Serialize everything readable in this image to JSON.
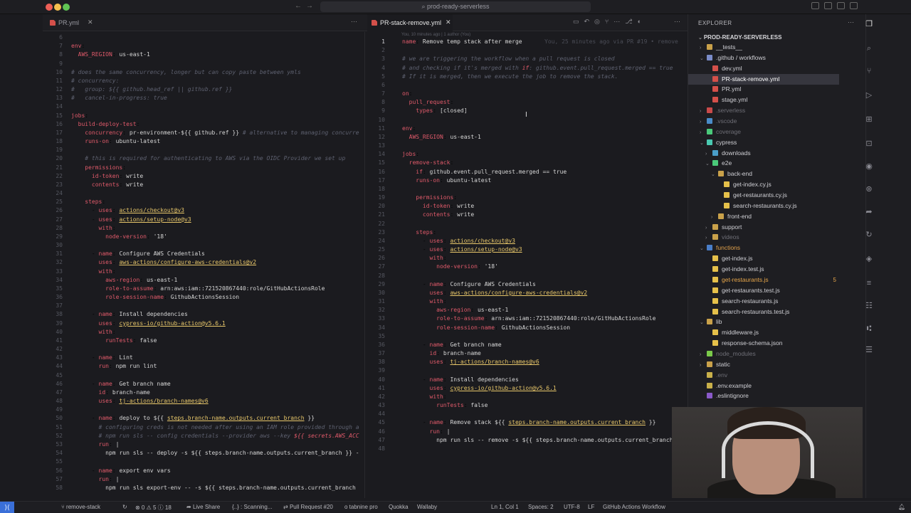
{
  "window": {
    "search_text": "prod-ready-serverless"
  },
  "tabs": {
    "left": {
      "label": "PR.yml"
    },
    "right": {
      "label": "PR-stack-remove.yml"
    }
  },
  "right_editor": {
    "blame_header": "You, 10 minutes ago | 1 author (You)",
    "inline_blame": "You, 25 minutes ago via PR #19 • remove",
    "lines": [
      {
        "n": "1",
        "html": "<span class='k'>name</span>: <span class='v'>Remove temp stack after merge</span>"
      },
      {
        "n": "2",
        "html": ""
      },
      {
        "n": "3",
        "html": "<span class='c'># we are triggering the workflow when a pull request is closed</span>"
      },
      {
        "n": "4",
        "html": "<span class='c'># and checking if it's merged with <span class='k'>if</span>: github.event.pull_request.merged == true</span>"
      },
      {
        "n": "5",
        "html": "<span class='c'># If it is merged, then we execute the job to remove the stack.</span>"
      },
      {
        "n": "6",
        "html": ""
      },
      {
        "n": "7",
        "html": "<span class='k'>on</span>:"
      },
      {
        "n": "8",
        "html": "  <span class='k'>pull_request</span>:"
      },
      {
        "n": "9",
        "html": "    <span class='k'>types</span>: <span class='v'>[closed]</span>"
      },
      {
        "n": "10",
        "html": ""
      },
      {
        "n": "11",
        "html": "<span class='k'>env</span>:"
      },
      {
        "n": "12",
        "html": "  <span class='k'>AWS_REGION</span>: <span class='v'>us-east-1</span>"
      },
      {
        "n": "13",
        "html": ""
      },
      {
        "n": "14",
        "html": "<span class='k'>jobs</span>:"
      },
      {
        "n": "15",
        "html": "  <span class='k'>remove-stack</span>:"
      },
      {
        "n": "16",
        "html": "    <span class='k'>if</span>: <span class='v'>github.event.pull_request.merged == true</span>"
      },
      {
        "n": "17",
        "html": "    <span class='k'>runs-on</span>: <span class='v'>ubuntu-latest</span>"
      },
      {
        "n": "18",
        "html": ""
      },
      {
        "n": "19",
        "html": "    <span class='k'>permissions</span>:"
      },
      {
        "n": "20",
        "html": "      <span class='k'>id-token</span>: <span class='v'>write</span>"
      },
      {
        "n": "21",
        "html": "      <span class='k'>contents</span>: <span class='v'>write</span>"
      },
      {
        "n": "22",
        "html": ""
      },
      {
        "n": "23",
        "html": "    <span class='k'>steps</span>:"
      },
      {
        "n": "24",
        "html": "      - <span class='k'>uses</span>: <span class='u'>actions/checkout@v3</span>"
      },
      {
        "n": "25",
        "html": "      - <span class='k'>uses</span>: <span class='u'>actions/setup-node@v3</span>"
      },
      {
        "n": "26",
        "html": "        <span class='k'>with</span>:"
      },
      {
        "n": "27",
        "html": "          <span class='k'>node-version</span>: <span class='v'>'18'</span>"
      },
      {
        "n": "28",
        "html": ""
      },
      {
        "n": "29",
        "html": "      - <span class='k'>name</span>: <span class='v'>Configure AWS Credentials</span>"
      },
      {
        "n": "30",
        "html": "        <span class='k'>uses</span>: <span class='u'>aws-actions/configure-aws-credentials@v2</span>"
      },
      {
        "n": "31",
        "html": "        <span class='k'>with</span>:"
      },
      {
        "n": "32",
        "html": "          <span class='k'>aws-region</span>: <span class='v'>us-east-1</span>"
      },
      {
        "n": "33",
        "html": "          <span class='k'>role-to-assume</span>: <span class='v'>arn:aws:iam::721520867440:role/GitHubActionsRole</span>"
      },
      {
        "n": "34",
        "html": "          <span class='k'>role-session-name</span>: <span class='v'>GithubActionsSession</span>"
      },
      {
        "n": "35",
        "html": ""
      },
      {
        "n": "36",
        "html": "      - <span class='k'>name</span>: <span class='v'>Get branch name</span>"
      },
      {
        "n": "37",
        "html": "        <span class='k'>id</span>: <span class='v'>branch-name</span>"
      },
      {
        "n": "38",
        "html": "        <span class='k'>uses</span>: <span class='u'>tj-actions/branch-names@v6</span>"
      },
      {
        "n": "39",
        "html": ""
      },
      {
        "n": "40",
        "html": "      - <span class='k'>name</span>: <span class='v'>Install dependencies</span>"
      },
      {
        "n": "41",
        "html": "        <span class='k'>uses</span>: <span class='u'>cypress-io/github-action@v5.6.1</span>"
      },
      {
        "n": "42",
        "html": "        <span class='k'>with</span>:"
      },
      {
        "n": "43",
        "html": "          <span class='k'>runTests</span>: <span class='v'>false</span>"
      },
      {
        "n": "44",
        "html": ""
      },
      {
        "n": "45",
        "html": "      - <span class='k'>name</span>: <span class='v'>Remove stack ${{ <span class='u'>steps.branch-name.outputs.current_branch</span> }}</span>"
      },
      {
        "n": "46",
        "html": "        <span class='k'>run</span>: <span class='v'>|</span>"
      },
      {
        "n": "47",
        "html": "          <span class='v'>npm run sls -- remove -s ${{ steps.branch-name.outputs.current_branch }}</span>"
      },
      {
        "n": "48",
        "html": ""
      }
    ]
  },
  "left_editor": {
    "lines": [
      {
        "n": "6",
        "html": ""
      },
      {
        "n": "7",
        "html": "<span class='k'>env</span>:"
      },
      {
        "n": "8",
        "html": "  <span class='k'>AWS_REGION</span>: <span class='v'>us-east-1</span>"
      },
      {
        "n": "9",
        "html": ""
      },
      {
        "n": "10",
        "html": "<span class='c'># does the same concurrency, longer but can copy paste between ymls</span>"
      },
      {
        "n": "11",
        "html": "<span class='c'># concurrency:</span>"
      },
      {
        "n": "12",
        "html": "<span class='c'>#   group: ${{ github.head_ref || github.ref }}</span>"
      },
      {
        "n": "13",
        "html": "<span class='c'>#   cancel-in-progress: true</span>"
      },
      {
        "n": "14",
        "html": ""
      },
      {
        "n": "15",
        "html": "<span class='k'>jobs</span>:"
      },
      {
        "n": "16",
        "html": "  <span class='k'>build-deploy-test</span>:"
      },
      {
        "n": "17",
        "html": "    <span class='k'>concurrency</span>: <span class='v'>pr-environment-${{ github.ref }}</span> <span class='c'># alternative to managing concurre</span>"
      },
      {
        "n": "18",
        "html": "    <span class='k'>runs-on</span>: <span class='v'>ubuntu-latest</span>"
      },
      {
        "n": "19",
        "html": ""
      },
      {
        "n": "20",
        "html": "    <span class='c'># this is required for authenticating to AWS via the OIDC Provider we set up</span>"
      },
      {
        "n": "21",
        "html": "    <span class='k'>permissions</span>:"
      },
      {
        "n": "22",
        "html": "      <span class='k'>id-token</span>: <span class='v'>write</span>"
      },
      {
        "n": "23",
        "html": "      <span class='k'>contents</span>: <span class='v'>write</span>"
      },
      {
        "n": "24",
        "html": ""
      },
      {
        "n": "25",
        "html": "    <span class='k'>steps</span>:"
      },
      {
        "n": "26",
        "html": "      - <span class='k'>uses</span>: <span class='u'>actions/checkout@v3</span>"
      },
      {
        "n": "27",
        "html": "      - <span class='k'>uses</span>: <span class='u'>actions/setup-node@v3</span>"
      },
      {
        "n": "28",
        "html": "        <span class='k'>with</span>:"
      },
      {
        "n": "29",
        "html": "          <span class='k'>node-version</span>: <span class='v'>'18'</span>"
      },
      {
        "n": "30",
        "html": ""
      },
      {
        "n": "31",
        "html": "      - <span class='k'>name</span>: <span class='v'>Configure AWS Credentials</span>"
      },
      {
        "n": "32",
        "html": "        <span class='k'>uses</span>: <span class='u'>aws-actions/configure-aws-credentials@v2</span>"
      },
      {
        "n": "33",
        "html": "        <span class='k'>with</span>:"
      },
      {
        "n": "34",
        "html": "          <span class='k'>aws-region</span>: <span class='v'>us-east-1</span>"
      },
      {
        "n": "35",
        "html": "          <span class='k'>role-to-assume</span>: <span class='v'>arn:aws:iam::721520867440:role/GitHubActionsRole</span>"
      },
      {
        "n": "36",
        "html": "          <span class='k'>role-session-name</span>: <span class='v'>GithubActionsSession</span>"
      },
      {
        "n": "37",
        "html": ""
      },
      {
        "n": "38",
        "html": "      - <span class='k'>name</span>: <span class='v'>Install dependencies</span>"
      },
      {
        "n": "39",
        "html": "        <span class='k'>uses</span>: <span class='u'>cypress-io/github-action@v5.6.1</span>"
      },
      {
        "n": "40",
        "html": "        <span class='k'>with</span>:"
      },
      {
        "n": "41",
        "html": "          <span class='k'>runTests</span>: <span class='v'>false</span>"
      },
      {
        "n": "42",
        "html": ""
      },
      {
        "n": "43",
        "html": "      - <span class='k'>name</span>: <span class='v'>Lint</span>"
      },
      {
        "n": "44",
        "html": "        <span class='k'>run</span>: <span class='v'>npm run lint</span>"
      },
      {
        "n": "45",
        "html": ""
      },
      {
        "n": "46",
        "html": "      - <span class='k'>name</span>: <span class='v'>Get branch name</span>"
      },
      {
        "n": "47",
        "html": "        <span class='k'>id</span>: <span class='v'>branch-name</span>"
      },
      {
        "n": "48",
        "html": "        <span class='k'>uses</span>: <span class='u'>tj-actions/branch-names@v6</span>"
      },
      {
        "n": "49",
        "html": ""
      },
      {
        "n": "50",
        "html": "      - <span class='k'>name</span>: <span class='v'>deploy to ${{ <span class='u'>steps.branch-name.outputs.current_branch</span> }}</span>"
      },
      {
        "n": "51",
        "html": "        <span class='c'># configuring creds is not needed after using an IAM role provided through a</span>"
      },
      {
        "n": "52",
        "html": "        <span class='c'># npm run sls -- config credentials --provider aws --key <span class='k'>${{ secrets.AWS_ACC</span></span>"
      },
      {
        "n": "53",
        "html": "        <span class='k'>run</span>: <span class='v'>|</span>"
      },
      {
        "n": "54",
        "html": "          <span class='v'>npm run sls -- deploy -s ${{ steps.branch-name.outputs.current_branch }} -</span>"
      },
      {
        "n": "55",
        "html": ""
      },
      {
        "n": "56",
        "html": "      - <span class='k'>name</span>: <span class='v'>export env vars</span>"
      },
      {
        "n": "57",
        "html": "        <span class='k'>run</span>: <span class='v'>|</span>"
      },
      {
        "n": "58",
        "html": "          <span class='v'>npm run sls export-env -- -s ${{ steps.branch-name.outputs.current_branch</span>"
      }
    ]
  },
  "explorer": {
    "title": "EXPLORER",
    "project": "PROD-READY-SERVERLESS",
    "items": [
      {
        "label": "__tests__",
        "depth": 1,
        "arrow": "›",
        "icon": "#c9a14a",
        "dim": false
      },
      {
        "label": ".github / workflows",
        "depth": 1,
        "arrow": "⌄",
        "icon": "#7b8cc9",
        "dim": false
      },
      {
        "label": "dev.yml",
        "depth": 2,
        "arrow": "",
        "icon": "#d4504a",
        "dim": false
      },
      {
        "label": "PR-stack-remove.yml",
        "depth": 2,
        "arrow": "",
        "icon": "#d4504a",
        "dim": false,
        "selected": true
      },
      {
        "label": "PR.yml",
        "depth": 2,
        "arrow": "",
        "icon": "#d4504a",
        "dim": false
      },
      {
        "label": "stage.yml",
        "depth": 2,
        "arrow": "",
        "icon": "#d4504a",
        "dim": false
      },
      {
        "label": ".serverless",
        "depth": 1,
        "arrow": "›",
        "icon": "#c94a4a",
        "dim": true
      },
      {
        "label": ".vscode",
        "depth": 1,
        "arrow": "›",
        "icon": "#4a8cc9",
        "dim": true
      },
      {
        "label": "coverage",
        "depth": 1,
        "arrow": "›",
        "icon": "#4ac97a",
        "dim": true
      },
      {
        "label": "cypress",
        "depth": 1,
        "arrow": "⌄",
        "icon": "#4ac9b0",
        "dim": false
      },
      {
        "label": "downloads",
        "depth": 2,
        "arrow": "›",
        "icon": "#4a9ec9",
        "dim": false
      },
      {
        "label": "e2e",
        "depth": 2,
        "arrow": "⌄",
        "icon": "#4ac97a",
        "dim": false
      },
      {
        "label": "back-end",
        "depth": 3,
        "arrow": "⌄",
        "icon": "#c9a14a",
        "dim": false
      },
      {
        "label": "get-index.cy.js",
        "depth": 4,
        "arrow": "",
        "icon": "#e5c04a",
        "dim": false
      },
      {
        "label": "get-restaurants.cy.js",
        "depth": 4,
        "arrow": "",
        "icon": "#e5c04a",
        "dim": false
      },
      {
        "label": "search-restaurants.cy.js",
        "depth": 4,
        "arrow": "",
        "icon": "#e5c04a",
        "dim": false
      },
      {
        "label": "front-end",
        "depth": 3,
        "arrow": "›",
        "icon": "#c9a14a",
        "dim": false
      },
      {
        "label": "support",
        "depth": 2,
        "arrow": "›",
        "icon": "#c9a14a",
        "dim": false
      },
      {
        "label": "videos",
        "depth": 2,
        "arrow": "›",
        "icon": "#c9a14a",
        "dim": true
      },
      {
        "label": "functions",
        "depth": 1,
        "arrow": "⌄",
        "icon": "#4a7ec9",
        "dim": false,
        "accent": "#e0a04a"
      },
      {
        "label": "get-index.js",
        "depth": 2,
        "arrow": "",
        "icon": "#e5c04a",
        "dim": false
      },
      {
        "label": "get-index.test.js",
        "depth": 2,
        "arrow": "",
        "icon": "#e5c04a",
        "dim": false
      },
      {
        "label": "get-restaurants.js",
        "depth": 2,
        "arrow": "",
        "icon": "#e5c04a",
        "dim": false,
        "accent": "#e5a54a",
        "badge": "5"
      },
      {
        "label": "get-restaurants.test.js",
        "depth": 2,
        "arrow": "",
        "icon": "#e5c04a",
        "dim": false
      },
      {
        "label": "search-restaurants.js",
        "depth": 2,
        "arrow": "",
        "icon": "#e5c04a",
        "dim": false
      },
      {
        "label": "search-restaurants.test.js",
        "depth": 2,
        "arrow": "",
        "icon": "#e5c04a",
        "dim": false
      },
      {
        "label": "lib",
        "depth": 1,
        "arrow": "⌄",
        "icon": "#c9a14a",
        "dim": false
      },
      {
        "label": "middleware.js",
        "depth": 2,
        "arrow": "",
        "icon": "#e5c04a",
        "dim": false
      },
      {
        "label": "response-schema.json",
        "depth": 2,
        "arrow": "",
        "icon": "#e5c04a",
        "dim": false
      },
      {
        "label": "node_modules",
        "depth": 1,
        "arrow": "›",
        "icon": "#7ac94a",
        "dim": true
      },
      {
        "label": "static",
        "depth": 1,
        "arrow": "›",
        "icon": "#c9a14a",
        "dim": false
      },
      {
        "label": ".env",
        "depth": 1,
        "arrow": "",
        "icon": "#c9b04a",
        "dim": true
      },
      {
        "label": ".env.example",
        "depth": 1,
        "arrow": "",
        "icon": "#c9b04a",
        "dim": false
      },
      {
        "label": ".eslintignore",
        "depth": 1,
        "arrow": "",
        "icon": "#8a5ac9",
        "dim": false
      }
    ]
  },
  "statusbar": {
    "branch": "remove-stack",
    "problems": "⊗ 0 ⚠ 5 ⓘ 18",
    "live_share": "Live Share",
    "scanning": "{..} : Scanning...",
    "pull_request": "Pull Request #20",
    "tabnine": "o tabnine pro",
    "quokka": "Quokka",
    "wallaby": "Wallaby",
    "position": "Ln 1, Col 1",
    "spaces": "Spaces: 2",
    "encoding": "UTF-8",
    "eol": "LF",
    "language": "GitHub Actions Workflow"
  },
  "colors": {
    "keyword": "#e05a6a",
    "comment": "#5e6170",
    "link": "#e8c76a",
    "accent": "#3a6fd8"
  }
}
